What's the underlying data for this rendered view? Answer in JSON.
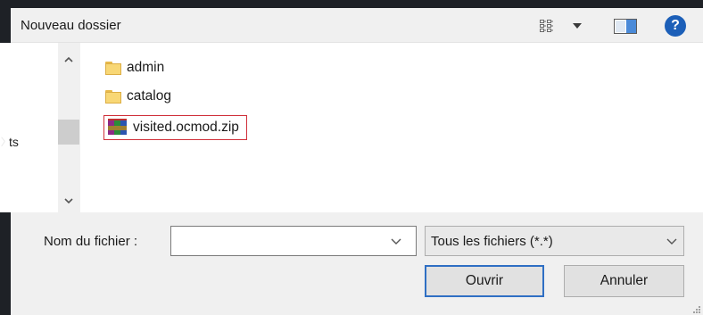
{
  "toolbar": {
    "new_folder_label": "Nouveau dossier",
    "help_label": "?"
  },
  "leftpane": {
    "partial_label": "ts"
  },
  "files": [
    {
      "name": "admin",
      "type": "folder"
    },
    {
      "name": "catalog",
      "type": "folder"
    },
    {
      "name": "visited.ocmod.zip",
      "type": "zip",
      "selected": true
    }
  ],
  "form": {
    "filename_label": "Nom du fichier :",
    "filename_value": "",
    "filetype_selected": "Tous les fichiers (*.*)",
    "open_label": "Ouvrir",
    "cancel_label": "Annuler"
  },
  "colors": {
    "accent": "#2f6fc4",
    "selection_border": "#d0303a",
    "folder": "#f8d775",
    "help": "#1c5fb8"
  },
  "icons": [
    "view-options-icon",
    "dropdown-arrow-icon",
    "preview-pane-icon",
    "help-icon",
    "folder-icon",
    "archive-icon",
    "scroll-up-icon",
    "scroll-down-icon",
    "chevron-down-icon",
    "resize-grip-icon"
  ]
}
